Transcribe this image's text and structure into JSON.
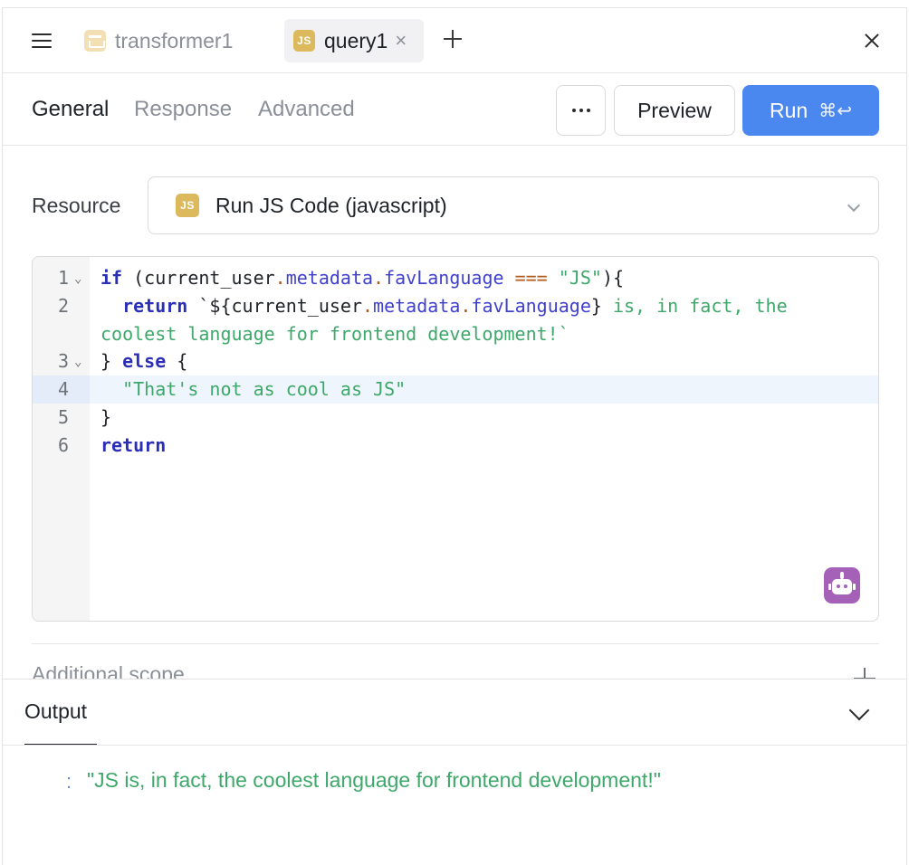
{
  "tabs": [
    {
      "label": "transformer1",
      "icon": "transformer-icon"
    },
    {
      "label": "query1",
      "badge": "JS",
      "icon": "js-icon"
    }
  ],
  "toolbar": {
    "subtabs": [
      "General",
      "Response",
      "Advanced"
    ],
    "active_subtab": "General",
    "preview_label": "Preview",
    "run_label": "Run",
    "run_shortcut": "⌘↩"
  },
  "resource": {
    "label": "Resource",
    "badge": "JS",
    "value": "Run JS Code (javascript)"
  },
  "editor": {
    "line_numbers": [
      "1",
      "2",
      "3",
      "4",
      "5",
      "6"
    ],
    "active_line": 4,
    "code": {
      "l1": {
        "kw": "if",
        "a": " (current_user",
        "d1": ".",
        "p1": "metadata",
        "d2": ".",
        "p2": "favLanguage",
        "op": " === ",
        "str": "\"JS\"",
        "end": "){"
      },
      "l2": {
        "indent": "  ",
        "kw": "return",
        "a": " `${current_user",
        "d1": ".",
        "p1": "metadata",
        "d2": ".",
        "p2": "favLanguage",
        "b": "}",
        "str": " is, in fact, the"
      },
      "l2b": {
        "str": "coolest language for frontend development!`"
      },
      "l3": {
        "a": "} ",
        "kw": "else",
        "b": " {"
      },
      "l4": {
        "str": "  \"That's not as cool as JS\""
      },
      "l5": {
        "a": "}"
      },
      "l6": {
        "kw": "return"
      }
    }
  },
  "scope": {
    "label": "Additional scope"
  },
  "output": {
    "tab_label": "Output",
    "colon": ":",
    "value": "\"JS is, in fact, the coolest language for frontend development!\""
  },
  "colors": {
    "accent": "#4a87ef",
    "string": "#3ea86a",
    "keyword": "#2b2fb8",
    "ai_button": "#a561b8",
    "js_badge": "#dcb95c"
  }
}
